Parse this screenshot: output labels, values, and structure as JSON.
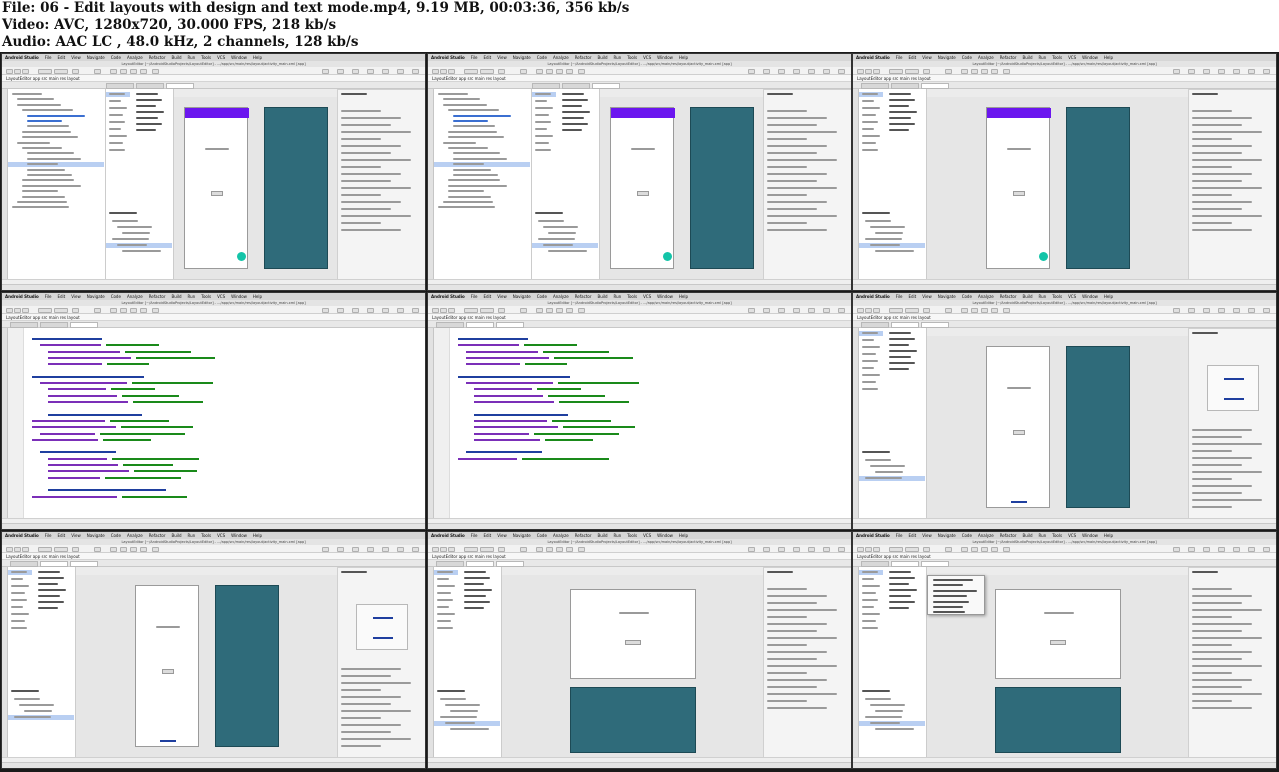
{
  "header": {
    "file_line": "File: 06 - Edit layouts with design and text mode.mp4, 9.19 MB, 00:03:36, 356 kb/s",
    "video_line": "Video: AVC, 1280x720, 30.000 FPS, 218 kb/s",
    "audio_line": "Audio: AAC LC , 48.0 kHz, 2 channels, 128 kb/s"
  },
  "menubar": {
    "app_name": "Android Studio",
    "items": [
      "File",
      "Edit",
      "View",
      "Navigate",
      "Code",
      "Analyze",
      "Refactor",
      "Build",
      "Run",
      "Tools",
      "VCS",
      "Window",
      "Help"
    ]
  },
  "window_title": "LayoutEditor [~/AndroidStudioProjects/LayoutEditor] - .../app/src/main/res/layout/activity_main.xml [app]",
  "breadcrumb": "LayoutEditor  app  src  main  res  layout",
  "colors": {
    "app_bar": "#6b16ef",
    "blueprint": "#2f6b7a",
    "fab": "#13c4a8",
    "selection": "#b9cff2"
  },
  "thumbnails": [
    {
      "mode": "design",
      "layout": "activity_main",
      "project_tree": true
    },
    {
      "mode": "design",
      "layout": "activity_main",
      "project_tree": true
    },
    {
      "mode": "design",
      "layout": "activity_main",
      "project_tree": false
    },
    {
      "mode": "code",
      "layout": "activity_main"
    },
    {
      "mode": "code",
      "layout": "content_main"
    },
    {
      "mode": "design",
      "layout": "content_main",
      "selected": "button"
    },
    {
      "mode": "design",
      "layout": "content_main",
      "selected": "button"
    },
    {
      "mode": "design",
      "layout": "content_main",
      "blueprint": "bottom"
    },
    {
      "mode": "design",
      "layout": "content_main",
      "blueprint": "bottom",
      "view_options_menu": true
    }
  ]
}
